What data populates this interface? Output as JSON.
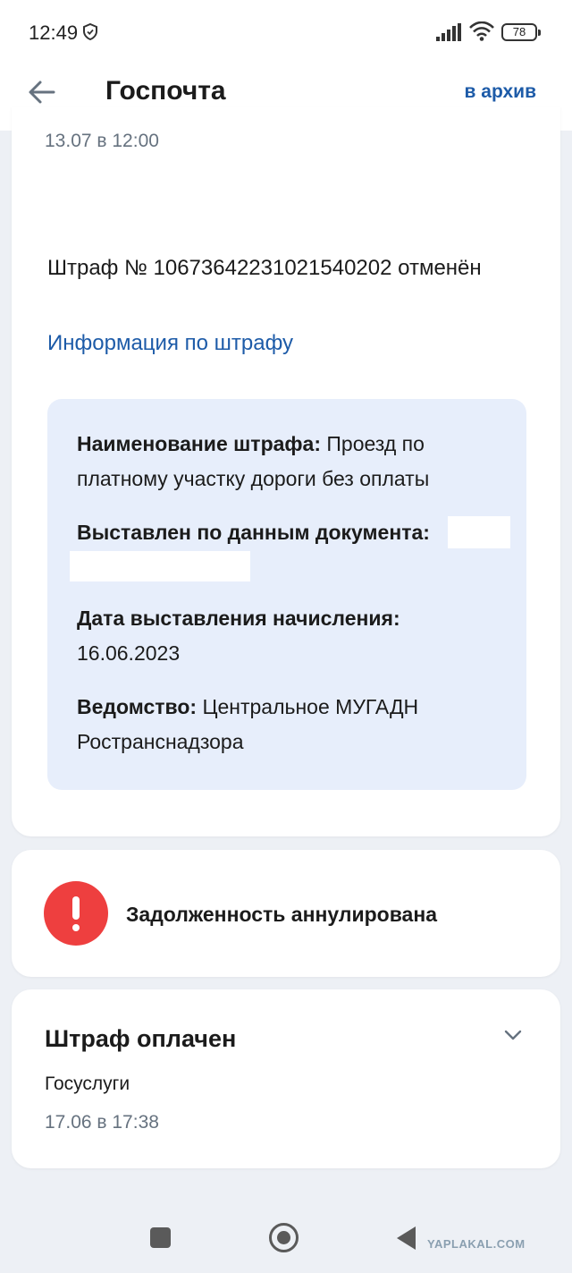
{
  "status_bar": {
    "time": "12:49",
    "battery": "78"
  },
  "header": {
    "title": "Госпочта",
    "archive_label": "в архив"
  },
  "notice": {
    "date": "13.07 в 12:00",
    "fine_title": "Штраф № 10673642231021540202 отменён",
    "fine_link": "Информация по штрафу",
    "details": {
      "name_label": "Наименование штрафа:",
      "name_value": "Проезд по платному участку дороги без оплаты",
      "doc_label": "Выставлен по данным документа:",
      "issue_label": "Дата выставления начисления:",
      "issue_value": "16.06.2023",
      "agency_label": "Ведомство:",
      "agency_value": "Центральное МУГАДН Ространснадзора"
    }
  },
  "debt": {
    "text": "Задолженность аннулирована",
    "icon_color": "#ee3f3f"
  },
  "payment": {
    "title": "Штраф оплачен",
    "source": "Госуслуги",
    "date": "17.06 в 17:38"
  },
  "watermark": "YAPLAKAL.COM",
  "colors": {
    "link": "#1d5ba8",
    "info_bg": "#e7eefb",
    "page_bg": "#edf0f5"
  }
}
